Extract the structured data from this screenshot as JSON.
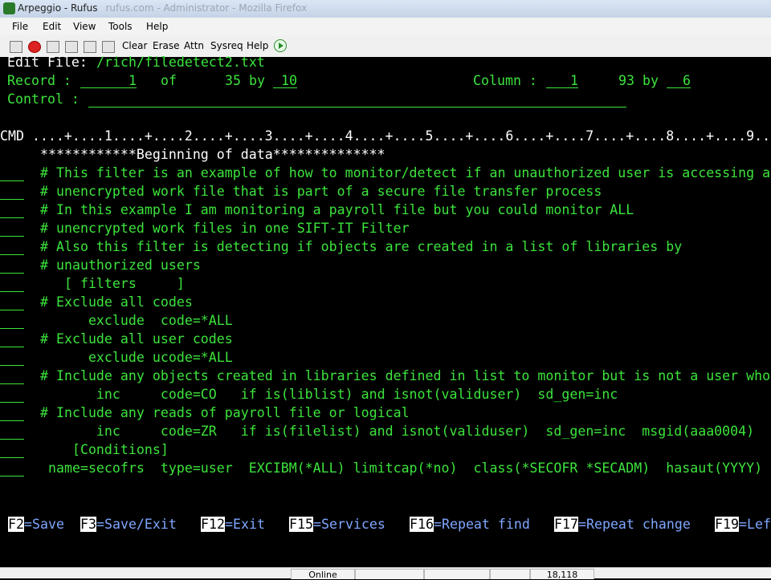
{
  "window": {
    "title": "Arpeggio - Rufus",
    "faded_title": "rufus.com - Administrator - Mozilla Firefox"
  },
  "menu": [
    "File",
    "Edit",
    "View",
    "Tools",
    "Help"
  ],
  "toolbar": {
    "icons": [
      "disk-icon",
      "bug-icon",
      "copy-icon",
      "paste-icon",
      "print-icon",
      "capture-icon"
    ],
    "buttons": [
      "Clear",
      "Erase",
      "Attn",
      "Sysreq",
      "Help"
    ]
  },
  "header": {
    "edit_file_label": "Edit File:",
    "edit_file_path": "/rich/filedetect2.txt",
    "record_label": "Record :",
    "record_value": "1",
    "of_label": "of",
    "of_value": "35",
    "by_label": "by",
    "by_value": "10",
    "column_label": "Column :",
    "column_value": "1",
    "col_total": "93",
    "col_by_label": "by",
    "col_by_value": "6",
    "control_label": "Control :"
  },
  "ruler": "CMD ....+....1....+....2....+....3....+....4....+....5....+....6....+....7....+....8....+....9....",
  "beginning_marker": "************Beginning of data**************",
  "lines": [
    "# This filter is an example of how to monitor/detect if an unauthorized user is accessing a",
    "# unencrypted work file that is part of a secure file transfer process",
    "# In this example I am monitoring a payroll file but you could monitor ALL",
    "# unencrypted work files in one SIFT-IT Filter",
    "# Also this filter is detecting if objects are created in a list of libraries by",
    "# unauthorized users",
    "   [ filters     ]",
    "# Exclude all codes",
    "      exclude  code=*ALL",
    "# Exclude all user codes",
    "      exclude ucode=*ALL",
    "# Include any objects created in libraries defined in list to monitor but is not a user who",
    "       inc     code=CO   if is(liblist) and isnot(validuser)  sd_gen=inc",
    "# Include any reads of payroll file or logical",
    "       inc     code=ZR   if is(filelist) and isnot(validuser)  sd_gen=inc  msgid(aaa0004)",
    "    [Conditions]",
    " name=secofrs  type=user  EXCIBM(*ALL) limitcap(*no)  class(*SECOFR *SECADM)  hasaut(YYYY)"
  ],
  "function_keys": [
    {
      "key": "F2",
      "desc": "=Save"
    },
    {
      "key": "F3",
      "desc": "=Save/Exit"
    },
    {
      "key": "F12",
      "desc": "=Exit"
    },
    {
      "key": "F15",
      "desc": "=Services"
    },
    {
      "key": "F16",
      "desc": "=Repeat find"
    },
    {
      "key": "F17",
      "desc": "=Repeat change"
    },
    {
      "key": "F19",
      "desc": "=Lef"
    }
  ],
  "status": {
    "mode": "Online",
    "position": "18,118"
  }
}
